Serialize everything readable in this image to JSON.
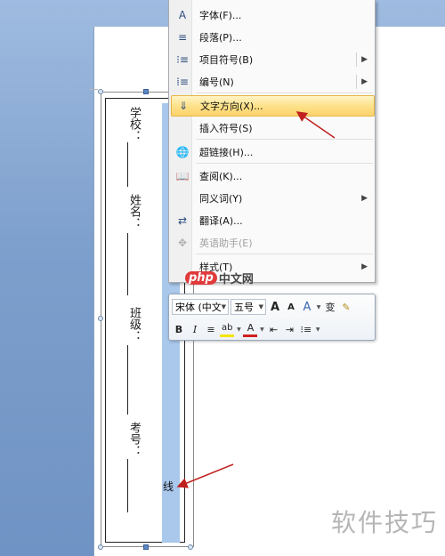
{
  "document": {
    "fields": [
      {
        "label": "学校："
      },
      {
        "label": "姓名："
      },
      {
        "label": "班级："
      },
      {
        "label": "考号："
      }
    ],
    "line_char": "线"
  },
  "context_menu": {
    "items": [
      {
        "icon": "font-icon",
        "glyph": "A",
        "label": "字体(F)...",
        "has_submenu": false,
        "enabled": true
      },
      {
        "icon": "paragraph-icon",
        "glyph": "≡",
        "label": "段落(P)...",
        "has_submenu": false,
        "enabled": true
      },
      {
        "icon": "bullets-icon",
        "glyph": "⁝≡",
        "label": "项目符号(B)",
        "has_submenu": true,
        "enabled": true
      },
      {
        "icon": "numbering-icon",
        "glyph": "⁞≡",
        "label": "编号(N)",
        "has_submenu": true,
        "enabled": true
      },
      {
        "icon": "text-direction-icon",
        "glyph": "⇓",
        "label": "文字方向(X)...",
        "has_submenu": false,
        "enabled": true,
        "highlighted": true
      },
      {
        "icon": "",
        "glyph": "",
        "label": "插入符号(S)",
        "has_submenu": false,
        "enabled": true
      },
      {
        "icon": "hyperlink-icon",
        "glyph": "🌐",
        "label": "超链接(H)...",
        "has_submenu": false,
        "enabled": true
      },
      {
        "icon": "lookup-icon",
        "glyph": "📖",
        "label": "查阅(K)...",
        "has_submenu": false,
        "enabled": true
      },
      {
        "icon": "",
        "glyph": "",
        "label": "同义词(Y)",
        "has_submenu": true,
        "enabled": true
      },
      {
        "icon": "translate-icon",
        "glyph": "⇄",
        "label": "翻译(A)...",
        "has_submenu": false,
        "enabled": true
      },
      {
        "icon": "english-assistant-icon",
        "glyph": "✥",
        "label": "英语助手(E)",
        "has_submenu": false,
        "enabled": false
      },
      {
        "icon": "",
        "glyph": "",
        "label": "样式(T)",
        "has_submenu": true,
        "enabled": true
      }
    ]
  },
  "mini_toolbar": {
    "font_name": "宋体 (中文",
    "font_size": "五号",
    "grow_font": "A",
    "shrink_font": "A",
    "styles": "A",
    "phonetic": "变",
    "format_painter": "✎",
    "bold": "B",
    "italic": "I",
    "center": "≡",
    "highlight": "ab",
    "font_color": "A",
    "decrease_indent": "⇤",
    "increase_indent": "⇥",
    "bullets": "⁝≡"
  },
  "watermarks": {
    "php_logo_left": "php",
    "php_logo_right": "中文网",
    "bottom_right": "软件技巧"
  },
  "colors": {
    "menu_highlight": "#fcd26b",
    "arrow": "#c0201e",
    "selection": "#a9c8ec"
  }
}
